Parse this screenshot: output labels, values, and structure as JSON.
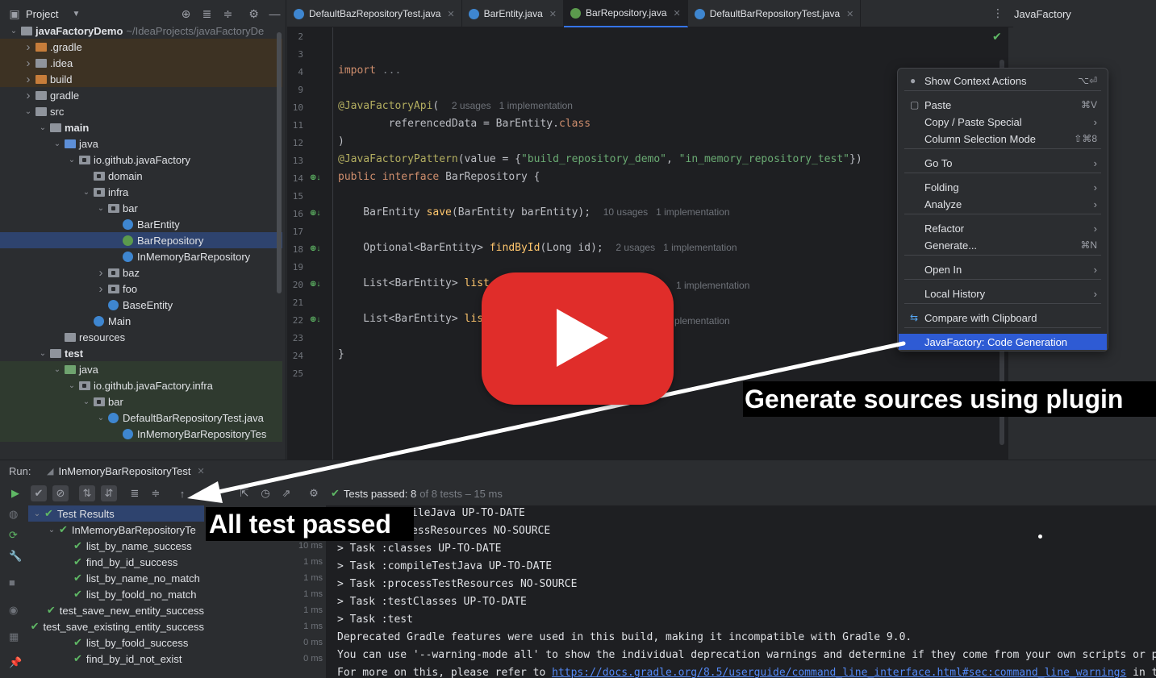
{
  "project": {
    "title": "Project",
    "tree": [
      {
        "label": "javaFactoryDemo",
        "sub": "~/IdeaProjects/javaFactoryDe",
        "depth": 0,
        "chev": "v",
        "icon": "folder",
        "bold": true,
        "style": ""
      },
      {
        "label": ".gradle",
        "depth": 1,
        "chev": ">",
        "icon": "folder-orange",
        "style": "excluded"
      },
      {
        "label": ".idea",
        "depth": 1,
        "chev": ">",
        "icon": "folder",
        "style": "excluded"
      },
      {
        "label": "build",
        "depth": 1,
        "chev": ">",
        "icon": "folder-orange",
        "style": "excluded"
      },
      {
        "label": "gradle",
        "depth": 1,
        "chev": ">",
        "icon": "folder",
        "style": ""
      },
      {
        "label": "src",
        "depth": 1,
        "chev": "v",
        "icon": "folder",
        "style": ""
      },
      {
        "label": "main",
        "depth": 2,
        "chev": "v",
        "icon": "folder",
        "bold": true,
        "style": ""
      },
      {
        "label": "java",
        "depth": 3,
        "chev": "v",
        "icon": "folder-blue",
        "style": ""
      },
      {
        "label": "io.github.javaFactory",
        "depth": 4,
        "chev": "v",
        "icon": "package",
        "style": ""
      },
      {
        "label": "domain",
        "depth": 5,
        "chev": "",
        "icon": "package",
        "style": ""
      },
      {
        "label": "infra",
        "depth": 5,
        "chev": "v",
        "icon": "package",
        "style": ""
      },
      {
        "label": "bar",
        "depth": 6,
        "chev": "v",
        "icon": "package",
        "style": ""
      },
      {
        "label": "BarEntity",
        "depth": 7,
        "chev": "",
        "icon": "class",
        "style": ""
      },
      {
        "label": "BarRepository",
        "depth": 7,
        "chev": "",
        "icon": "interface",
        "style": "selected"
      },
      {
        "label": "InMemoryBarRepository",
        "depth": 7,
        "chev": "",
        "icon": "class",
        "style": ""
      },
      {
        "label": "baz",
        "depth": 6,
        "chev": ">",
        "icon": "package",
        "style": ""
      },
      {
        "label": "foo",
        "depth": 6,
        "chev": ">",
        "icon": "package",
        "style": ""
      },
      {
        "label": "BaseEntity",
        "depth": 6,
        "chev": "",
        "icon": "class",
        "style": ""
      },
      {
        "label": "Main",
        "depth": 5,
        "chev": "",
        "icon": "class",
        "style": ""
      },
      {
        "label": "resources",
        "depth": 3,
        "chev": "",
        "icon": "folder",
        "style": ""
      },
      {
        "label": "test",
        "depth": 2,
        "chev": "v",
        "icon": "folder",
        "bold": true,
        "style": ""
      },
      {
        "label": "java",
        "depth": 3,
        "chev": "v",
        "icon": "folder-green",
        "style": "testbg"
      },
      {
        "label": "io.github.javaFactory.infra",
        "depth": 4,
        "chev": "v",
        "icon": "package",
        "style": "testbg"
      },
      {
        "label": "bar",
        "depth": 5,
        "chev": "v",
        "icon": "package",
        "style": "testbg"
      },
      {
        "label": "DefaultBarRepositoryTest.java",
        "depth": 6,
        "chev": "v",
        "icon": "class",
        "style": "testbg"
      },
      {
        "label": "InMemoryBarRepositoryTes",
        "depth": 7,
        "chev": "",
        "icon": "class",
        "style": "testbg"
      }
    ]
  },
  "tabs": [
    {
      "label": "DefaultBazRepositoryTest.java",
      "icon": "class",
      "active": false
    },
    {
      "label": "BarEntity.java",
      "icon": "class",
      "active": false
    },
    {
      "label": "BarRepository.java",
      "icon": "interface",
      "active": true
    },
    {
      "label": "DefaultBarRepositoryTest.java",
      "icon": "class",
      "active": false
    }
  ],
  "right_panel_title": "JavaFactory",
  "editor": {
    "line_numbers": [
      "2",
      "3",
      "4",
      "9",
      "10",
      "11",
      "12",
      "13",
      "14",
      "15",
      "16",
      "17",
      "18",
      "19",
      "20",
      "21",
      "22",
      "23",
      "24",
      "25"
    ],
    "lines": {
      "import_kw": "import",
      "import_dots": " ...",
      "l10_ann": "@JavaFactoryApi",
      "l10_paren": "(",
      "l10_hint": "2 usages   1 implementation",
      "l11_a": "        referencedData = BarEntity.",
      "l11_b": "class",
      "l12": ")",
      "l13_ann": "@JavaFactoryPattern",
      "l13_a": "(value = {",
      "l13_s1": "\"build_repository_demo\"",
      "l13_b": ", ",
      "l13_s2": "\"in_memory_repository_test\"",
      "l13_c": "})",
      "l14_kw": "public interface ",
      "l14_name": "BarRepository {",
      "l16_a": "    BarEntity ",
      "l16_fn": "save",
      "l16_b": "(BarEntity barEntity);",
      "l16_hint": "10 usages   1 implementation",
      "l18_a": "    Optional<BarEntity> ",
      "l18_fn": "findById",
      "l18_b": "(Long id);",
      "l18_hint": "2 usages   1 implementation",
      "l20_a": "    List<BarEntity> ",
      "l20_fn": "list",
      "l20_hint": "1 implementation",
      "l22_a": "    List<BarEntity> ",
      "l22_fn": "lis",
      "l22_hint": "plementation",
      "l24": "}"
    }
  },
  "context_menu": {
    "items": [
      {
        "label": "Show Context Actions",
        "shortcut": "⌥⏎",
        "icon": "bulb-icon"
      },
      {
        "label": "Paste",
        "shortcut": "⌘V",
        "icon": "clipboard-icon"
      },
      {
        "label": "Copy / Paste Special",
        "arrow": "›"
      },
      {
        "label": "Column Selection Mode",
        "shortcut": "⇧⌘8"
      },
      {
        "label": "Go To",
        "arrow": "›"
      },
      {
        "label": "Folding",
        "arrow": "›"
      },
      {
        "label": "Analyze",
        "arrow": "›"
      },
      {
        "label": "Refactor",
        "arrow": "›"
      },
      {
        "label": "Generate...",
        "shortcut": "⌘N"
      },
      {
        "label": "Open In",
        "arrow": "›"
      },
      {
        "label": "Local History",
        "arrow": "›"
      },
      {
        "label": "Compare with Clipboard",
        "icon": "compare-icon"
      },
      {
        "label": "JavaFactory: Code Generation",
        "selected": true
      }
    ]
  },
  "run": {
    "label": "Run:",
    "tab": "InMemoryBarRepositoryTest",
    "status_main": "Tests passed: 8",
    "status_dim": "of 8 tests – 15 ms",
    "results": [
      {
        "label": "Test Results",
        "depth": 0,
        "time": "",
        "chev": "v",
        "selected": true
      },
      {
        "label": "InMemoryBarRepositoryTe",
        "depth": 1,
        "time": "",
        "chev": "v"
      },
      {
        "label": "list_by_name_success",
        "depth": 2,
        "time": "10 ms"
      },
      {
        "label": "find_by_id_success",
        "depth": 2,
        "time": "1 ms"
      },
      {
        "label": "list_by_name_no_match",
        "depth": 2,
        "time": "1 ms"
      },
      {
        "label": "list_by_foold_no_match",
        "depth": 2,
        "time": "1 ms"
      },
      {
        "label": "test_save_new_entity_success",
        "depth": 2,
        "time": "1 ms"
      },
      {
        "label": "test_save_existing_entity_success",
        "depth": 2,
        "time": "1 ms"
      },
      {
        "label": "list_by_foold_success",
        "depth": 2,
        "time": "0 ms"
      },
      {
        "label": "find_by_id_not_exist",
        "depth": 2,
        "time": "0 ms"
      }
    ],
    "console": [
      "ileJava UP-TO-DATE",
      "essResources NO-SOURCE",
      "> Task :classes UP-TO-DATE",
      "> Task :compileTestJava UP-TO-DATE",
      "> Task :processTestResources NO-SOURCE",
      "> Task :testClasses UP-TO-DATE",
      "> Task :test",
      "Deprecated Gradle features were used in this build, making it incompatible with Gradle 9.0.",
      "You can use '--warning-mode all' to show the individual deprecation warnings and determine if they come from your own scripts or p"
    ],
    "console_last_prefix": "For more on this, please refer to ",
    "console_last_link": "https://docs.gradle.org/8.5/userguide/command_line_interface.html#sec:command_line_warnings",
    "console_last_suffix": " in t"
  },
  "overlay": {
    "caption_generate": "Generate sources using plugin",
    "caption_tests": "All test passed"
  },
  "colors": {
    "accent": "#3574f0",
    "menu_selected": "#2e5bd4",
    "pass_green": "#5fb865",
    "youtube_red": "#e02d2a"
  }
}
